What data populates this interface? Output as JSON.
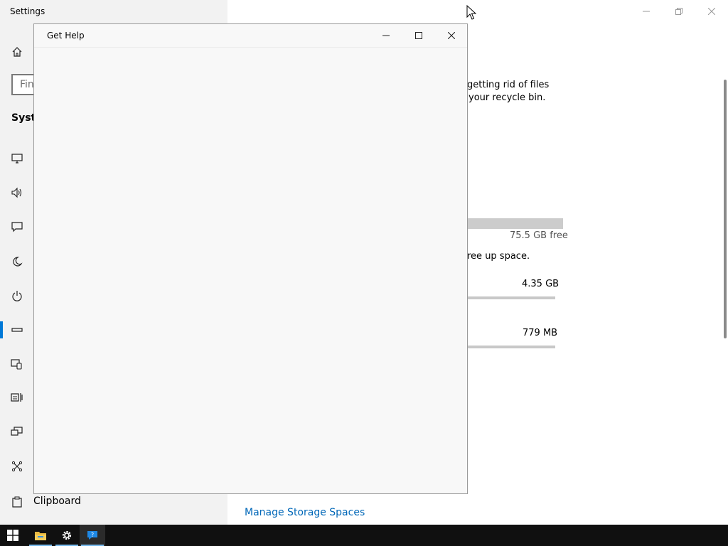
{
  "settings": {
    "title": "Settings",
    "search_placeholder": "Fin",
    "section_title": "Syste",
    "clipboard_label": "Clipboard",
    "nav_icons": [
      "home-icon",
      "display-icon",
      "sound-icon",
      "notifications-icon",
      "focus-assist-icon",
      "power-icon",
      "storage-icon",
      "tablet-icon",
      "multitasking-icon",
      "projecting-icon",
      "shared-experiences-icon"
    ]
  },
  "content": {
    "line1": "getting rid of files",
    "line2": "your recycle bin.",
    "free_label": "75.5 GB free",
    "free_up": "ree up space.",
    "item1_size": "4.35 GB",
    "item2_size": "779 MB",
    "manage_link": "Manage Storage Spaces"
  },
  "gethelp": {
    "title": "Get Help"
  },
  "taskbar": {
    "items": [
      "start-icon",
      "file-explorer-icon",
      "settings-icon",
      "get-help-icon"
    ]
  },
  "colors": {
    "accent": "#0078d7",
    "link": "#0067b8",
    "taskbar": "#101010"
  }
}
